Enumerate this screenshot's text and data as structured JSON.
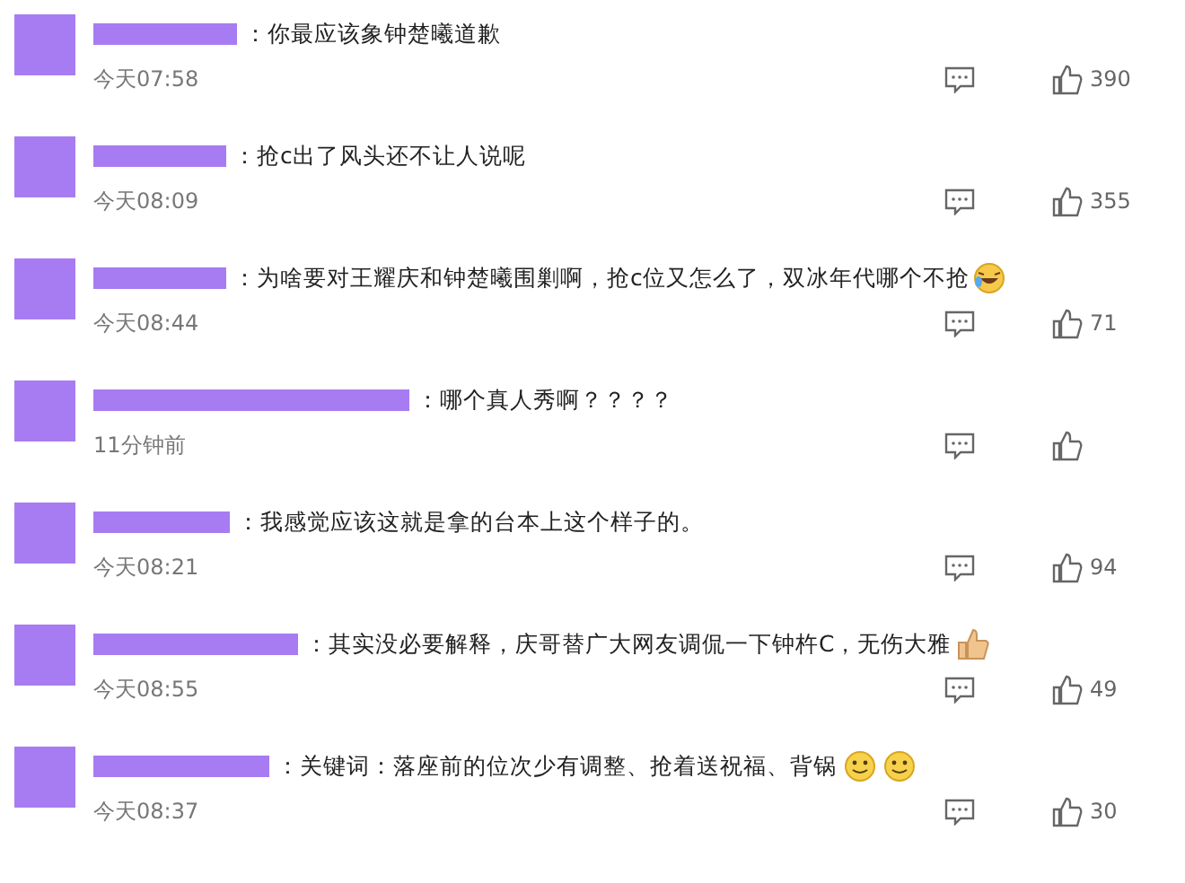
{
  "comments": [
    {
      "text": "：你最应该象钟楚曦道歉",
      "time": "今天07:58",
      "likes": "390"
    },
    {
      "text": "：抢c出了风头还不让人说呢",
      "time": "今天08:09",
      "likes": "355"
    },
    {
      "text": "：为啥要对王耀庆和钟楚曦围剿啊，抢c位又怎么了，双冰年代哪个不抢",
      "time": "今天08:44",
      "likes": "71",
      "emojis": [
        {
          "kind": "laughcry"
        }
      ]
    },
    {
      "text": "：哪个真人秀啊？？？？",
      "time": "11分钟前"
    },
    {
      "text": "：我感觉应该这就是拿的台本上这个样子的。",
      "time": "今天08:21",
      "likes": "94"
    },
    {
      "text": "：其实没必要解释，庆哥替广大网友调侃一下钟杵C，无伤大雅",
      "time": "今天08:55",
      "likes": "49",
      "emojis": [
        {
          "kind": "thumbsup"
        }
      ]
    },
    {
      "text": "：关键词：落座前的位次少有调整、抢着送祝福、背锅",
      "time": "今天08:37",
      "likes": "30",
      "emojis": [
        {
          "kind": "smile"
        },
        {
          "kind": "smile"
        }
      ]
    }
  ]
}
